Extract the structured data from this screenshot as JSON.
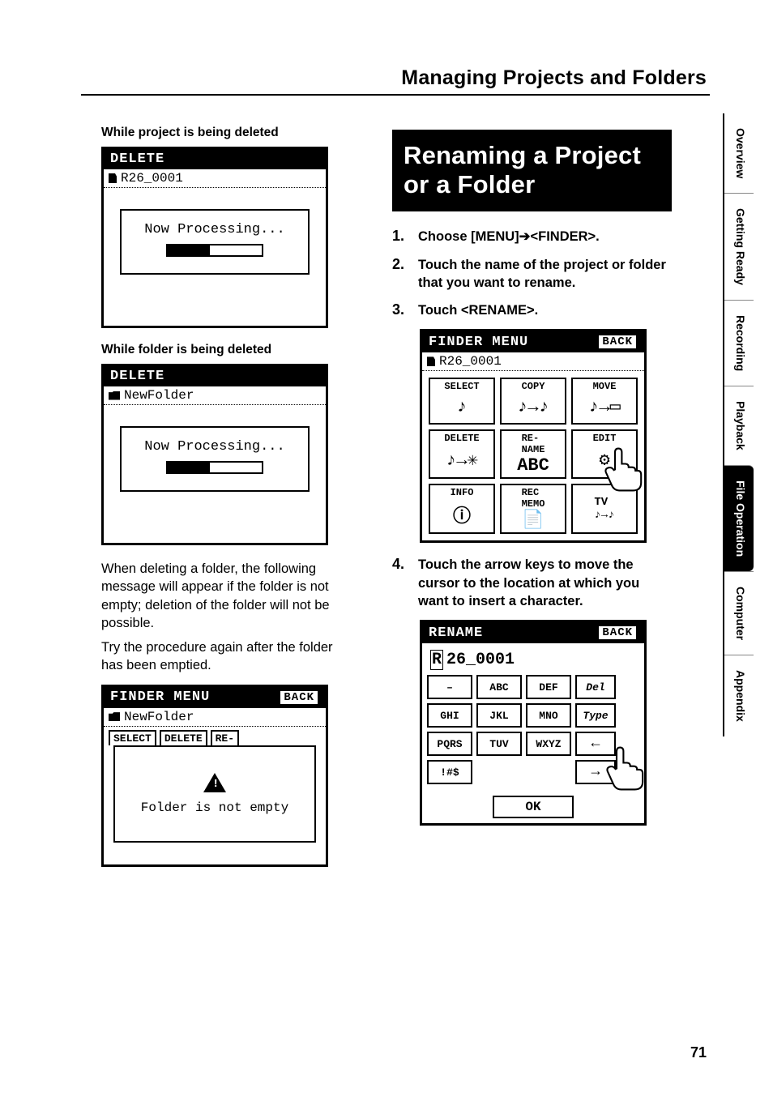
{
  "header": {
    "section_title": "Managing Projects and Folders"
  },
  "left": {
    "caption1": "While project is being deleted",
    "lcd1": {
      "title": "DELETE",
      "subtitle": "R26_0001",
      "body": "Now Processing..."
    },
    "caption2": "While folder is being deleted",
    "lcd2": {
      "title": "DELETE",
      "subtitle": "NewFolder",
      "body": "Now Processing..."
    },
    "para1": "When deleting a folder, the following message will appear if the folder is not empty; deletion of the folder will not be possible.",
    "para2": "Try the procedure again after the folder has been emptied.",
    "lcd3": {
      "title": "FINDER MENU",
      "back": "BACK",
      "subtitle": "NewFolder",
      "tabs": [
        "SELECT",
        "DELETE",
        "RE-"
      ],
      "msg": "Folder is not empty"
    }
  },
  "right": {
    "heading": "Renaming a Project or a Folder",
    "steps": [
      {
        "n": "1.",
        "t": "Choose [MENU]➔<FINDER>."
      },
      {
        "n": "2.",
        "t": "Touch the name of the project or folder that you want to rename."
      },
      {
        "n": "3.",
        "t": "Touch <RENAME>."
      },
      {
        "n": "4.",
        "t": "Touch the arrow keys to move the cursor to the location at which you want to insert a character."
      }
    ],
    "finder": {
      "title": "FINDER MENU",
      "back": "BACK",
      "subtitle": "R26_0001",
      "cells": [
        "SELECT",
        "COPY",
        "MOVE",
        "DELETE",
        "RE-\nNAME",
        "EDIT",
        "INFO",
        "REC\nMEMO",
        ""
      ]
    },
    "rename": {
      "title": "RENAME",
      "back": "BACK",
      "name_pre": "R",
      "name_rest": "26_0001",
      "keys_row1": [
        "–",
        "ABC",
        "DEF"
      ],
      "keys_row2": [
        "GHI",
        "JKL",
        "MNO"
      ],
      "keys_row3": [
        "PQRS",
        "TUV",
        "WXYZ"
      ],
      "keys_row4": [
        "!#$"
      ],
      "side": {
        "del": "Del",
        "type": "Type",
        "left": "←",
        "right": "→"
      },
      "ok": "OK"
    }
  },
  "tabs": [
    "Overview",
    "Getting Ready",
    "Recording",
    "Playback",
    "File Operation",
    "Computer",
    "Appendix"
  ],
  "active_tab_index": 4,
  "page_number": "71"
}
